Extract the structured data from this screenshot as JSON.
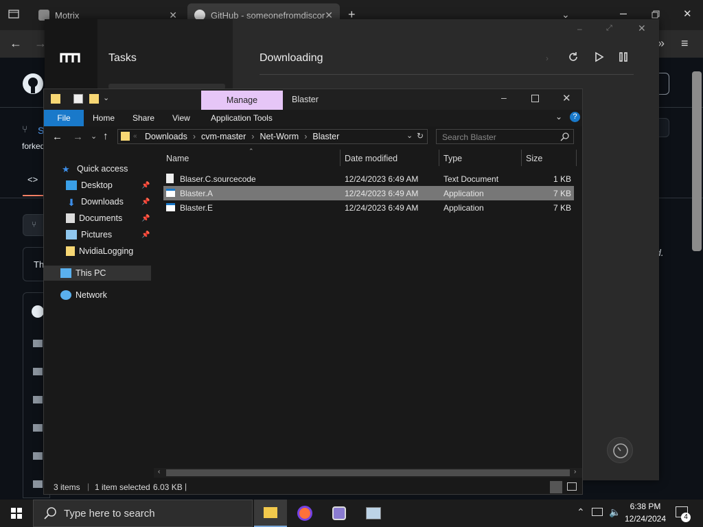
{
  "browser": {
    "tabs": [
      {
        "label": "Motrix"
      },
      {
        "label": "GitHub - someonefromdiscord"
      }
    ]
  },
  "github": {
    "repo_initial": "S",
    "forked_text": "forked",
    "code_tab": "<>",
    "banner_text": "Th",
    "italic_d": "d."
  },
  "motrix": {
    "nav_title": "Tasks",
    "main_title": "Downloading"
  },
  "explorer": {
    "window_title": "Blaster",
    "manage_tab": "Manage",
    "ribbon_tabs": [
      "File",
      "Home",
      "Share",
      "View",
      "Application Tools"
    ],
    "breadcrumb": [
      "Downloads",
      "cvm-master",
      "Net-Worm",
      "Blaster"
    ],
    "search_placeholder": "Search Blaster",
    "nav": {
      "quick_access": "Quick access",
      "desktop": "Desktop",
      "downloads": "Downloads",
      "documents": "Documents",
      "pictures": "Pictures",
      "nvidia": "NvidiaLogging",
      "this_pc": "This PC",
      "network": "Network"
    },
    "columns": {
      "name": "Name",
      "date": "Date modified",
      "type": "Type",
      "size": "Size"
    },
    "files": [
      {
        "name": "Blaser.C.sourcecode",
        "date": "12/24/2023 6:49 AM",
        "type": "Text Document",
        "size": "1 KB"
      },
      {
        "name": "Blaster.A",
        "date": "12/24/2023 6:49 AM",
        "type": "Application",
        "size": "7 KB"
      },
      {
        "name": "Blaster.E",
        "date": "12/24/2023 6:49 AM",
        "type": "Application",
        "size": "7 KB"
      }
    ],
    "status": {
      "items": "3 items",
      "selected": "1 item selected",
      "size": "6.03 KB"
    }
  },
  "taskbar": {
    "search_placeholder": "Type here to search",
    "time": "6:38 PM",
    "date": "12/24/2024",
    "notification_count": "4"
  },
  "colors": {
    "accent_blue": "#0078d7",
    "manage_tab": "#e6c6f7",
    "selected_row": "#777777"
  }
}
